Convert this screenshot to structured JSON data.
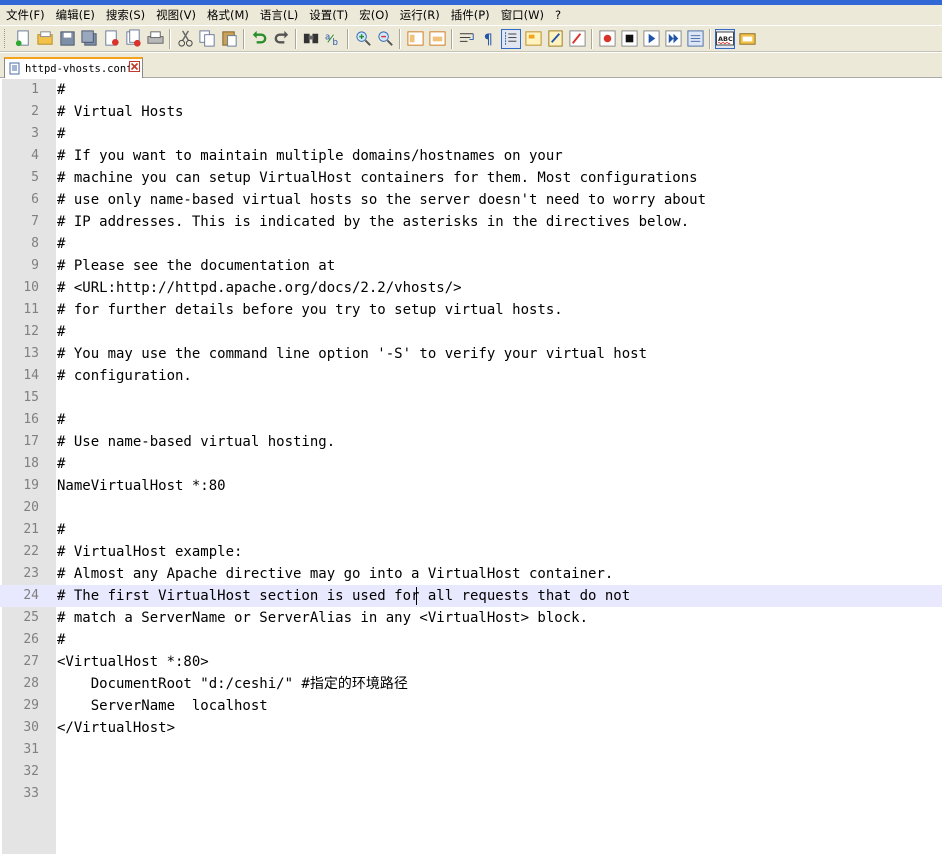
{
  "app": {
    "menu": [
      "文件(F)",
      "编辑(E)",
      "搜索(S)",
      "视图(V)",
      "格式(M)",
      "语言(L)",
      "设置(T)",
      "宏(O)",
      "运行(R)",
      "插件(P)",
      "窗口(W)",
      "?"
    ]
  },
  "toolbar": {
    "icons": [
      "new-file-icon",
      "open-file-icon",
      "save-icon",
      "save-all-icon",
      "close-icon",
      "close-all-icon",
      "print-icon",
      "cut-icon",
      "copy-icon",
      "paste-icon",
      "undo-icon",
      "redo-icon",
      "find-icon",
      "replace-icon",
      "zoom-in-icon",
      "zoom-out-icon",
      "sync-vertical-icon",
      "sync-horizontal-icon",
      "word-wrap-icon",
      "show-all-chars-icon",
      "indent-guide-icon",
      "user-language-icon",
      "doc-map-icon",
      "function-list-icon",
      "record-macro-icon",
      "stop-macro-icon",
      "play-macro-icon",
      "run-macro-multiple-icon",
      "save-macro-icon",
      "spell-check-icon",
      "preview-icon"
    ],
    "spell_label": "ABC"
  },
  "tabs": [
    {
      "label": "httpd-vhosts.conf",
      "active": true
    }
  ],
  "editor": {
    "current_line": 24,
    "lines": [
      "#",
      "# Virtual Hosts",
      "#",
      "# If you want to maintain multiple domains/hostnames on your",
      "# machine you can setup VirtualHost containers for them. Most configurations",
      "# use only name-based virtual hosts so the server doesn't need to worry about",
      "# IP addresses. This is indicated by the asterisks in the directives below.",
      "#",
      "# Please see the documentation at",
      "# <URL:http://httpd.apache.org/docs/2.2/vhosts/>",
      "# for further details before you try to setup virtual hosts.",
      "#",
      "# You may use the command line option '-S' to verify your virtual host",
      "# configuration.",
      "",
      "#",
      "# Use name-based virtual hosting.",
      "#",
      "NameVirtualHost *:80",
      "",
      "#",
      "# VirtualHost example:",
      "# Almost any Apache directive may go into a VirtualHost container.",
      "# The first VirtualHost section is used for all requests that do not",
      "# match a ServerName or ServerAlias in any <VirtualHost> block.",
      "#",
      "<VirtualHost *:80>",
      "    DocumentRoot \"d:/ceshi/\" #指定的环境路径",
      "    ServerName  localhost",
      "</VirtualHost>",
      "",
      "",
      ""
    ]
  },
  "colors": {
    "gutter": "#e4e4e4",
    "current_line": "#e8e8ff",
    "chrome": "#ece9d8",
    "tab_accent": "#f7a21b"
  }
}
